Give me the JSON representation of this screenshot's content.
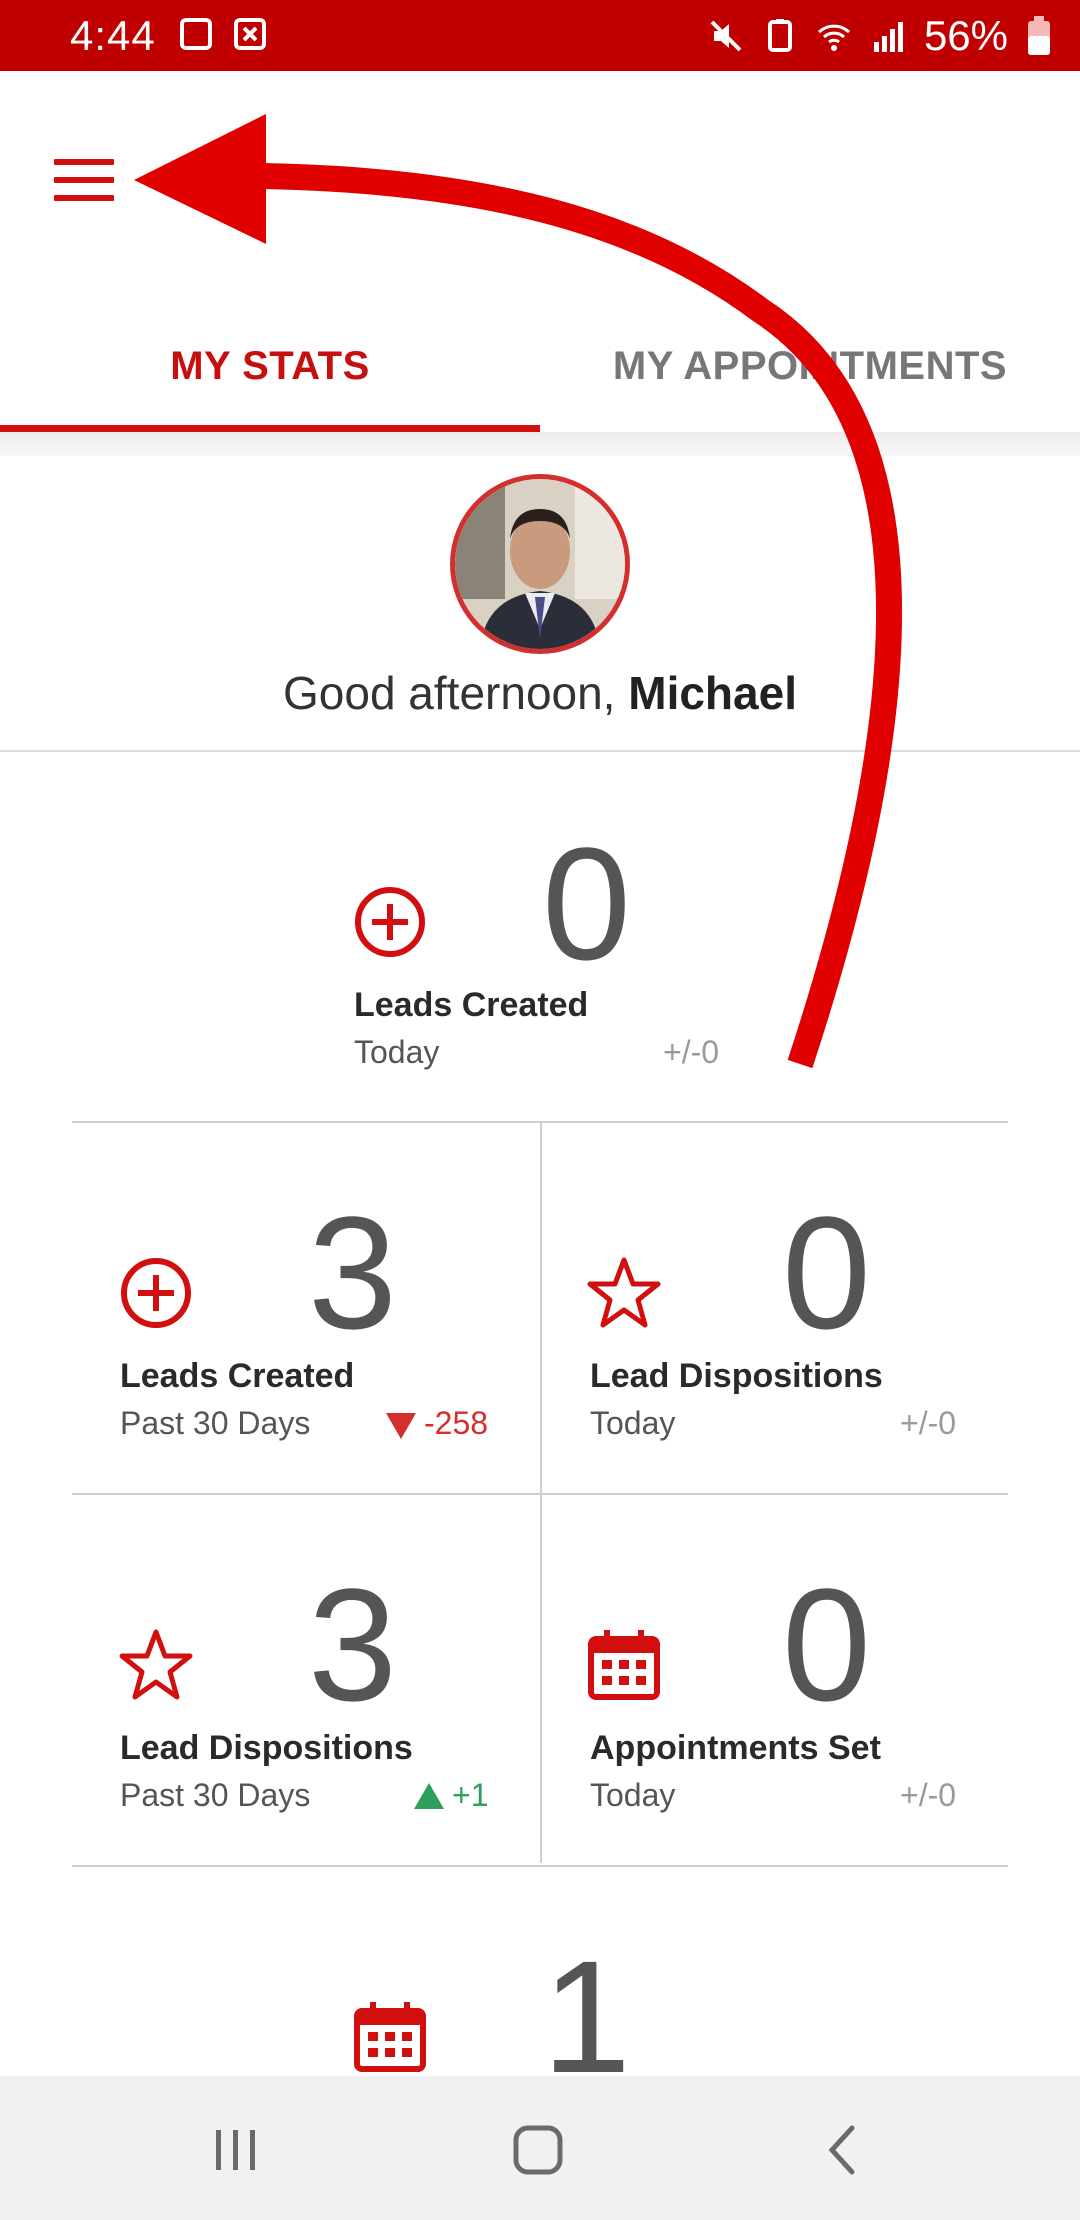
{
  "status_bar": {
    "time": "4:44",
    "battery": "56%",
    "icons": [
      "calendar-notif-icon",
      "close-notif-icon",
      "mute-icon",
      "battery-saver-icon",
      "wifi-icon",
      "signal-icon",
      "battery-icon"
    ]
  },
  "header": {
    "menu_icon": "hamburger-menu-icon"
  },
  "tabs": [
    {
      "label": "MY STATS",
      "active": true
    },
    {
      "label": "MY APPOINTMENTS",
      "active": false
    }
  ],
  "profile": {
    "greeting_prefix": "Good afternoon, ",
    "name": "Michael"
  },
  "stats": [
    {
      "value": "0",
      "label": "Leads Created",
      "period": "Today",
      "delta": "+/-0",
      "icon": "plus-circle-icon"
    },
    {
      "value": "3",
      "label": "Leads Created",
      "period": "Past 30 Days",
      "delta": "-258",
      "trend": "down",
      "icon": "plus-circle-icon"
    },
    {
      "value": "0",
      "label": "Lead Dispositions",
      "period": "Today",
      "delta": "+/-0",
      "icon": "star-icon"
    },
    {
      "value": "3",
      "label": "Lead Dispositions",
      "period": "Past 30 Days",
      "delta": "+1",
      "trend": "up",
      "icon": "star-icon"
    },
    {
      "value": "0",
      "label": "Appointments Set",
      "period": "Today",
      "delta": "+/-0",
      "icon": "calendar-icon"
    },
    {
      "value": "1",
      "icon": "calendar-icon"
    }
  ],
  "nav_bar": {
    "icons": [
      "recent-apps-icon",
      "home-icon",
      "back-icon"
    ]
  },
  "colors": {
    "brand_red": "#c00000",
    "accent_red": "#d10f0f",
    "positive": "#2e9e5b",
    "negative": "#d32f2f"
  }
}
